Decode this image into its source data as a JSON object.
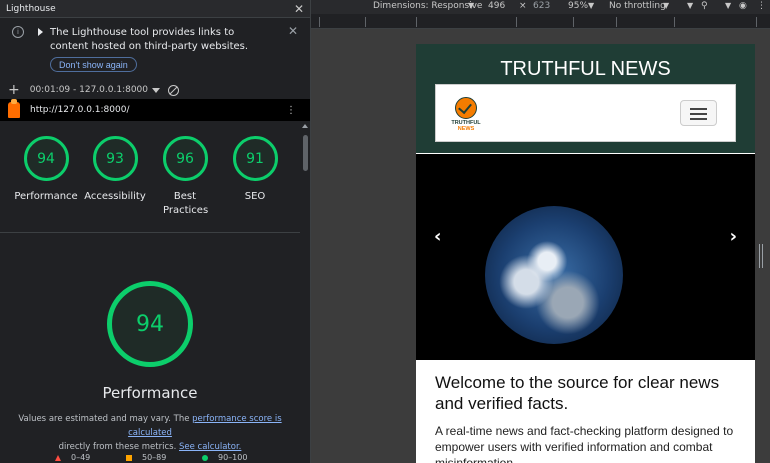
{
  "panel": {
    "title": "Lighthouse",
    "info_text": "The Lighthouse tool provides links to content hosted on third-party websites.",
    "dont_show_label": "Don't show again",
    "timestamp": "00:01:09 - 127.0.0.1:8000",
    "url": "http://127.0.0.1:8000/"
  },
  "scores": [
    {
      "value": "94",
      "label": "Performance"
    },
    {
      "value": "93",
      "label": "Accessibility"
    },
    {
      "value": "96",
      "label": "Best Practices"
    },
    {
      "value": "91",
      "label": "SEO"
    }
  ],
  "performance": {
    "score": "94",
    "title": "Performance",
    "note_prefix": "Values are estimated and may vary. The",
    "note_link": "performance score is calculated",
    "note_middle": "directly from these metrics.",
    "note_link2": "See calculator.",
    "legend": [
      "0–49",
      "50–89",
      "90–100"
    ]
  },
  "devtools_bar": {
    "dimensions_label": "Dimensions: Responsive",
    "width": "496",
    "x": "×",
    "height": "623",
    "zoom": "95%",
    "throttle": "No throttling"
  },
  "site": {
    "title": "TRUTHFUL NEWS",
    "logo_line1": "TRUTHFUL",
    "logo_line2": "NEWS",
    "prev": "‹",
    "next": "›",
    "welcome": "Welcome to the source for clear news and verified facts.",
    "intro": "A real-time news and fact-checking platform designed to empower users with verified information and combat misinformation."
  },
  "colors": {
    "good": "#0cce6b",
    "average": "#ffa400",
    "poor": "#ff4e42",
    "site_header": "#1f3d35"
  }
}
